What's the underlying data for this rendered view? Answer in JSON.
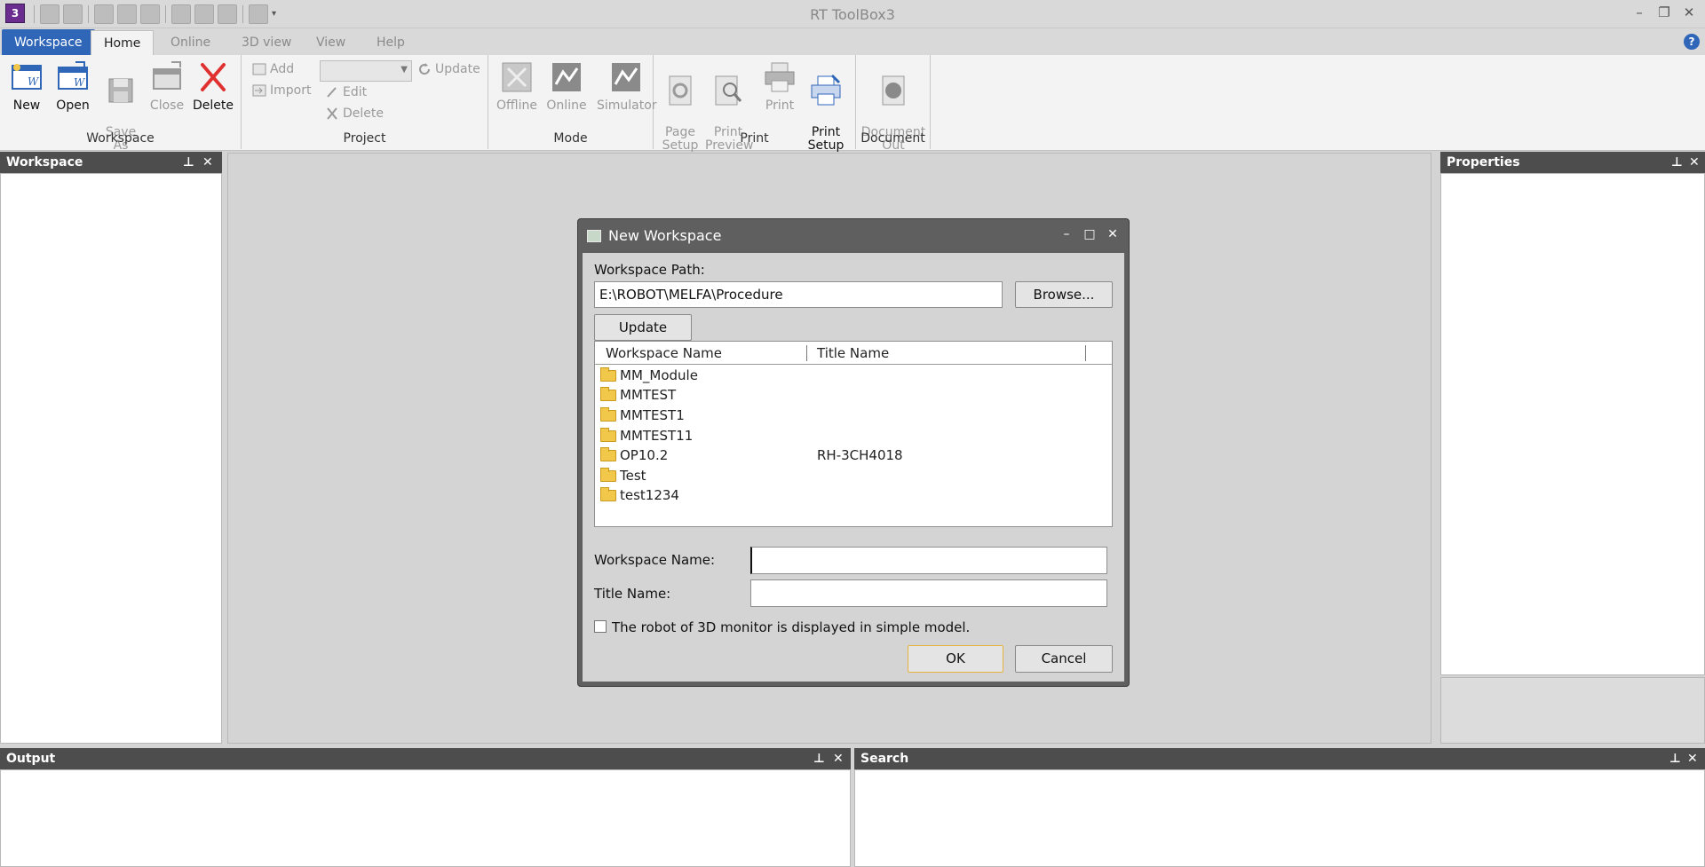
{
  "app": {
    "title": "RT ToolBox3",
    "icon_letter": "3",
    "help_icon": "?"
  },
  "window_controls": {
    "minimize": "–",
    "restore": "❐",
    "close": "✕"
  },
  "ribbon": {
    "tabs": [
      "Workspace",
      "Home",
      "Online",
      "3D view",
      "View",
      "Help"
    ],
    "groups": {
      "workspace": {
        "label": "Workspace",
        "new": "New",
        "open": "Open",
        "save_as": "Save\nAs",
        "close": "Close",
        "delete": "Delete"
      },
      "project": {
        "label": "Project",
        "add": "Add",
        "import": "Import",
        "edit": "Edit",
        "delete": "Delete",
        "update": "Update"
      },
      "mode": {
        "label": "Mode",
        "offline": "Offline",
        "online": "Online",
        "simulator": "Simulator"
      },
      "print": {
        "label": "Print",
        "page_setup": "Page\nSetup",
        "print_preview": "Print\nPreview",
        "print": "Print",
        "print_setup": "Print\nSetup"
      },
      "document": {
        "label": "Document",
        "document_out": "Document\nOut"
      }
    }
  },
  "panels": {
    "workspace": "Workspace",
    "properties": "Properties",
    "output": "Output",
    "search": "Search",
    "pin_icon": "📌",
    "close_icon": "✕"
  },
  "dialog": {
    "title": "New Workspace",
    "controls": {
      "minimize": "–",
      "maximize": "□",
      "close": "✕"
    },
    "path_label": "Workspace Path:",
    "path_value": "E:\\ROBOT\\MELFA\\Procedure",
    "browse": "Browse...",
    "update": "Update",
    "columns": [
      "Workspace Name",
      "Title Name"
    ],
    "rows": [
      {
        "name": "MM_Module",
        "title": ""
      },
      {
        "name": "MMTEST",
        "title": ""
      },
      {
        "name": "MMTEST1",
        "title": ""
      },
      {
        "name": "MMTEST11",
        "title": ""
      },
      {
        "name": "OP10.2",
        "title": "RH-3CH4018"
      },
      {
        "name": "Test",
        "title": ""
      },
      {
        "name": "test1234",
        "title": ""
      }
    ],
    "workspace_name_label": "Workspace Name:",
    "workspace_name_value": "",
    "title_name_label": "Title Name:",
    "title_name_value": "",
    "checkbox_label": "The robot of 3D monitor is displayed in simple model.",
    "checkbox_checked": false,
    "ok": "OK",
    "cancel": "Cancel"
  }
}
